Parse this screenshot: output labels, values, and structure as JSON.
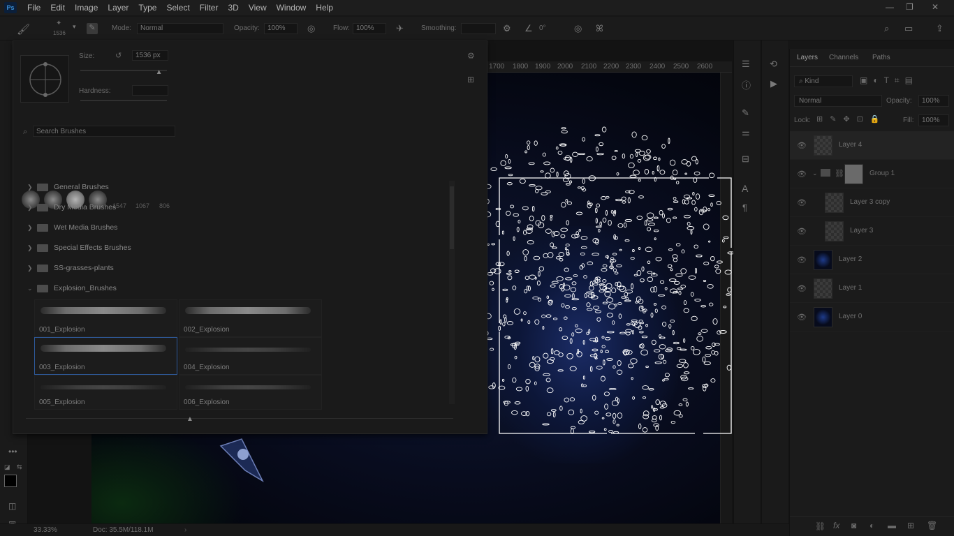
{
  "app": {
    "logo": "Ps"
  },
  "menu": [
    "File",
    "Edit",
    "Image",
    "Layer",
    "Type",
    "Select",
    "Filter",
    "3D",
    "View",
    "Window",
    "Help"
  ],
  "window_controls": {
    "minimize": "—",
    "restore": "❐",
    "close": "✕"
  },
  "options_bar": {
    "brush_size": "1536",
    "mode_label": "Mode:",
    "mode_value": "Normal",
    "opacity_label": "Opacity:",
    "opacity_value": "100%",
    "flow_label": "Flow:",
    "flow_value": "100%",
    "smoothing_label": "Smoothing:",
    "smoothing_value": "",
    "angle_value": "0°"
  },
  "brush_panel": {
    "size_label": "Size:",
    "size_value": "1536 px",
    "hardness_label": "Hardness:",
    "hardness_value": "",
    "size_slider_level": 0.9,
    "search_placeholder": "Search Brushes",
    "recent_sizes": [
      "1547",
      "1067",
      "806"
    ],
    "folders": [
      {
        "label": "General Brushes",
        "open": false
      },
      {
        "label": "Dry Media Brushes",
        "open": false
      },
      {
        "label": "Wet Media Brushes",
        "open": false
      },
      {
        "label": "Special Effects Brushes",
        "open": false
      },
      {
        "label": "SS-grasses-plants",
        "open": false
      },
      {
        "label": "Explosion_Brushes",
        "open": true
      }
    ],
    "brushes": [
      {
        "name": "001_Explosion",
        "selected": false
      },
      {
        "name": "002_Explosion",
        "selected": false
      },
      {
        "name": "003_Explosion",
        "selected": true
      },
      {
        "name": "004_Explosion",
        "selected": false
      },
      {
        "name": "005_Explosion",
        "selected": false
      },
      {
        "name": "006_Explosion",
        "selected": false
      }
    ]
  },
  "ruler": [
    "1700",
    "1800",
    "1900",
    "2000",
    "2100",
    "2200",
    "2300",
    "2400",
    "2500",
    "2600"
  ],
  "layers_panel": {
    "tabs": [
      "Layers",
      "Channels",
      "Paths"
    ],
    "filter_kind": "Kind",
    "blend_mode": "Normal",
    "opacity_label": "Opacity:",
    "opacity_value": "100%",
    "lock_label": "Lock:",
    "fill_label": "Fill:",
    "fill_value": "100%",
    "layers": [
      {
        "name": "Layer 4",
        "thumb": "transparent",
        "selected": true,
        "indent": false,
        "group": false
      },
      {
        "name": "Group 1",
        "thumb": "mask",
        "selected": false,
        "indent": false,
        "group": true
      },
      {
        "name": "Layer 3 copy",
        "thumb": "transparent",
        "selected": false,
        "indent": true,
        "group": false
      },
      {
        "name": "Layer 3",
        "thumb": "transparent",
        "selected": false,
        "indent": true,
        "group": false
      },
      {
        "name": "Layer 2",
        "thumb": "dark",
        "selected": false,
        "indent": false,
        "group": false
      },
      {
        "name": "Layer 1",
        "thumb": "transparent",
        "selected": false,
        "indent": false,
        "group": false
      },
      {
        "name": "Layer 0",
        "thumb": "dark",
        "selected": false,
        "indent": false,
        "group": false
      }
    ]
  },
  "status": {
    "zoom": "33.33%",
    "doc": "Doc: 35.5M/118.1M"
  }
}
